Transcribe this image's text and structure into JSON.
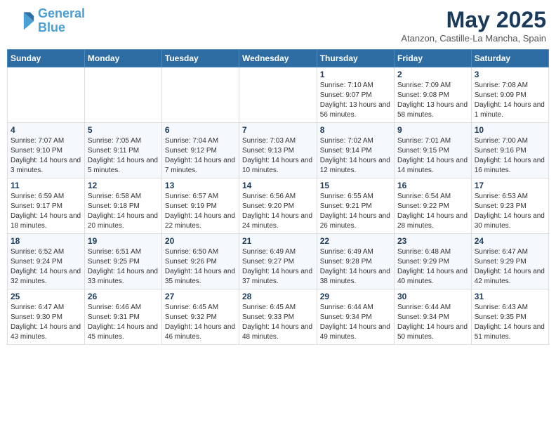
{
  "header": {
    "logo_line1": "General",
    "logo_line2": "Blue",
    "month_title": "May 2025",
    "location": "Atanzon, Castille-La Mancha, Spain"
  },
  "days_of_week": [
    "Sunday",
    "Monday",
    "Tuesday",
    "Wednesday",
    "Thursday",
    "Friday",
    "Saturday"
  ],
  "weeks": [
    [
      {
        "num": "",
        "info": ""
      },
      {
        "num": "",
        "info": ""
      },
      {
        "num": "",
        "info": ""
      },
      {
        "num": "",
        "info": ""
      },
      {
        "num": "1",
        "info": "Sunrise: 7:10 AM\nSunset: 9:07 PM\nDaylight: 13 hours and 56 minutes."
      },
      {
        "num": "2",
        "info": "Sunrise: 7:09 AM\nSunset: 9:08 PM\nDaylight: 13 hours and 58 minutes."
      },
      {
        "num": "3",
        "info": "Sunrise: 7:08 AM\nSunset: 9:09 PM\nDaylight: 14 hours and 1 minute."
      }
    ],
    [
      {
        "num": "4",
        "info": "Sunrise: 7:07 AM\nSunset: 9:10 PM\nDaylight: 14 hours and 3 minutes."
      },
      {
        "num": "5",
        "info": "Sunrise: 7:05 AM\nSunset: 9:11 PM\nDaylight: 14 hours and 5 minutes."
      },
      {
        "num": "6",
        "info": "Sunrise: 7:04 AM\nSunset: 9:12 PM\nDaylight: 14 hours and 7 minutes."
      },
      {
        "num": "7",
        "info": "Sunrise: 7:03 AM\nSunset: 9:13 PM\nDaylight: 14 hours and 10 minutes."
      },
      {
        "num": "8",
        "info": "Sunrise: 7:02 AM\nSunset: 9:14 PM\nDaylight: 14 hours and 12 minutes."
      },
      {
        "num": "9",
        "info": "Sunrise: 7:01 AM\nSunset: 9:15 PM\nDaylight: 14 hours and 14 minutes."
      },
      {
        "num": "10",
        "info": "Sunrise: 7:00 AM\nSunset: 9:16 PM\nDaylight: 14 hours and 16 minutes."
      }
    ],
    [
      {
        "num": "11",
        "info": "Sunrise: 6:59 AM\nSunset: 9:17 PM\nDaylight: 14 hours and 18 minutes."
      },
      {
        "num": "12",
        "info": "Sunrise: 6:58 AM\nSunset: 9:18 PM\nDaylight: 14 hours and 20 minutes."
      },
      {
        "num": "13",
        "info": "Sunrise: 6:57 AM\nSunset: 9:19 PM\nDaylight: 14 hours and 22 minutes."
      },
      {
        "num": "14",
        "info": "Sunrise: 6:56 AM\nSunset: 9:20 PM\nDaylight: 14 hours and 24 minutes."
      },
      {
        "num": "15",
        "info": "Sunrise: 6:55 AM\nSunset: 9:21 PM\nDaylight: 14 hours and 26 minutes."
      },
      {
        "num": "16",
        "info": "Sunrise: 6:54 AM\nSunset: 9:22 PM\nDaylight: 14 hours and 28 minutes."
      },
      {
        "num": "17",
        "info": "Sunrise: 6:53 AM\nSunset: 9:23 PM\nDaylight: 14 hours and 30 minutes."
      }
    ],
    [
      {
        "num": "18",
        "info": "Sunrise: 6:52 AM\nSunset: 9:24 PM\nDaylight: 14 hours and 32 minutes."
      },
      {
        "num": "19",
        "info": "Sunrise: 6:51 AM\nSunset: 9:25 PM\nDaylight: 14 hours and 33 minutes."
      },
      {
        "num": "20",
        "info": "Sunrise: 6:50 AM\nSunset: 9:26 PM\nDaylight: 14 hours and 35 minutes."
      },
      {
        "num": "21",
        "info": "Sunrise: 6:49 AM\nSunset: 9:27 PM\nDaylight: 14 hours and 37 minutes."
      },
      {
        "num": "22",
        "info": "Sunrise: 6:49 AM\nSunset: 9:28 PM\nDaylight: 14 hours and 38 minutes."
      },
      {
        "num": "23",
        "info": "Sunrise: 6:48 AM\nSunset: 9:29 PM\nDaylight: 14 hours and 40 minutes."
      },
      {
        "num": "24",
        "info": "Sunrise: 6:47 AM\nSunset: 9:29 PM\nDaylight: 14 hours and 42 minutes."
      }
    ],
    [
      {
        "num": "25",
        "info": "Sunrise: 6:47 AM\nSunset: 9:30 PM\nDaylight: 14 hours and 43 minutes."
      },
      {
        "num": "26",
        "info": "Sunrise: 6:46 AM\nSunset: 9:31 PM\nDaylight: 14 hours and 45 minutes."
      },
      {
        "num": "27",
        "info": "Sunrise: 6:45 AM\nSunset: 9:32 PM\nDaylight: 14 hours and 46 minutes."
      },
      {
        "num": "28",
        "info": "Sunrise: 6:45 AM\nSunset: 9:33 PM\nDaylight: 14 hours and 48 minutes."
      },
      {
        "num": "29",
        "info": "Sunrise: 6:44 AM\nSunset: 9:34 PM\nDaylight: 14 hours and 49 minutes."
      },
      {
        "num": "30",
        "info": "Sunrise: 6:44 AM\nSunset: 9:34 PM\nDaylight: 14 hours and 50 minutes."
      },
      {
        "num": "31",
        "info": "Sunrise: 6:43 AM\nSunset: 9:35 PM\nDaylight: 14 hours and 51 minutes."
      }
    ]
  ]
}
